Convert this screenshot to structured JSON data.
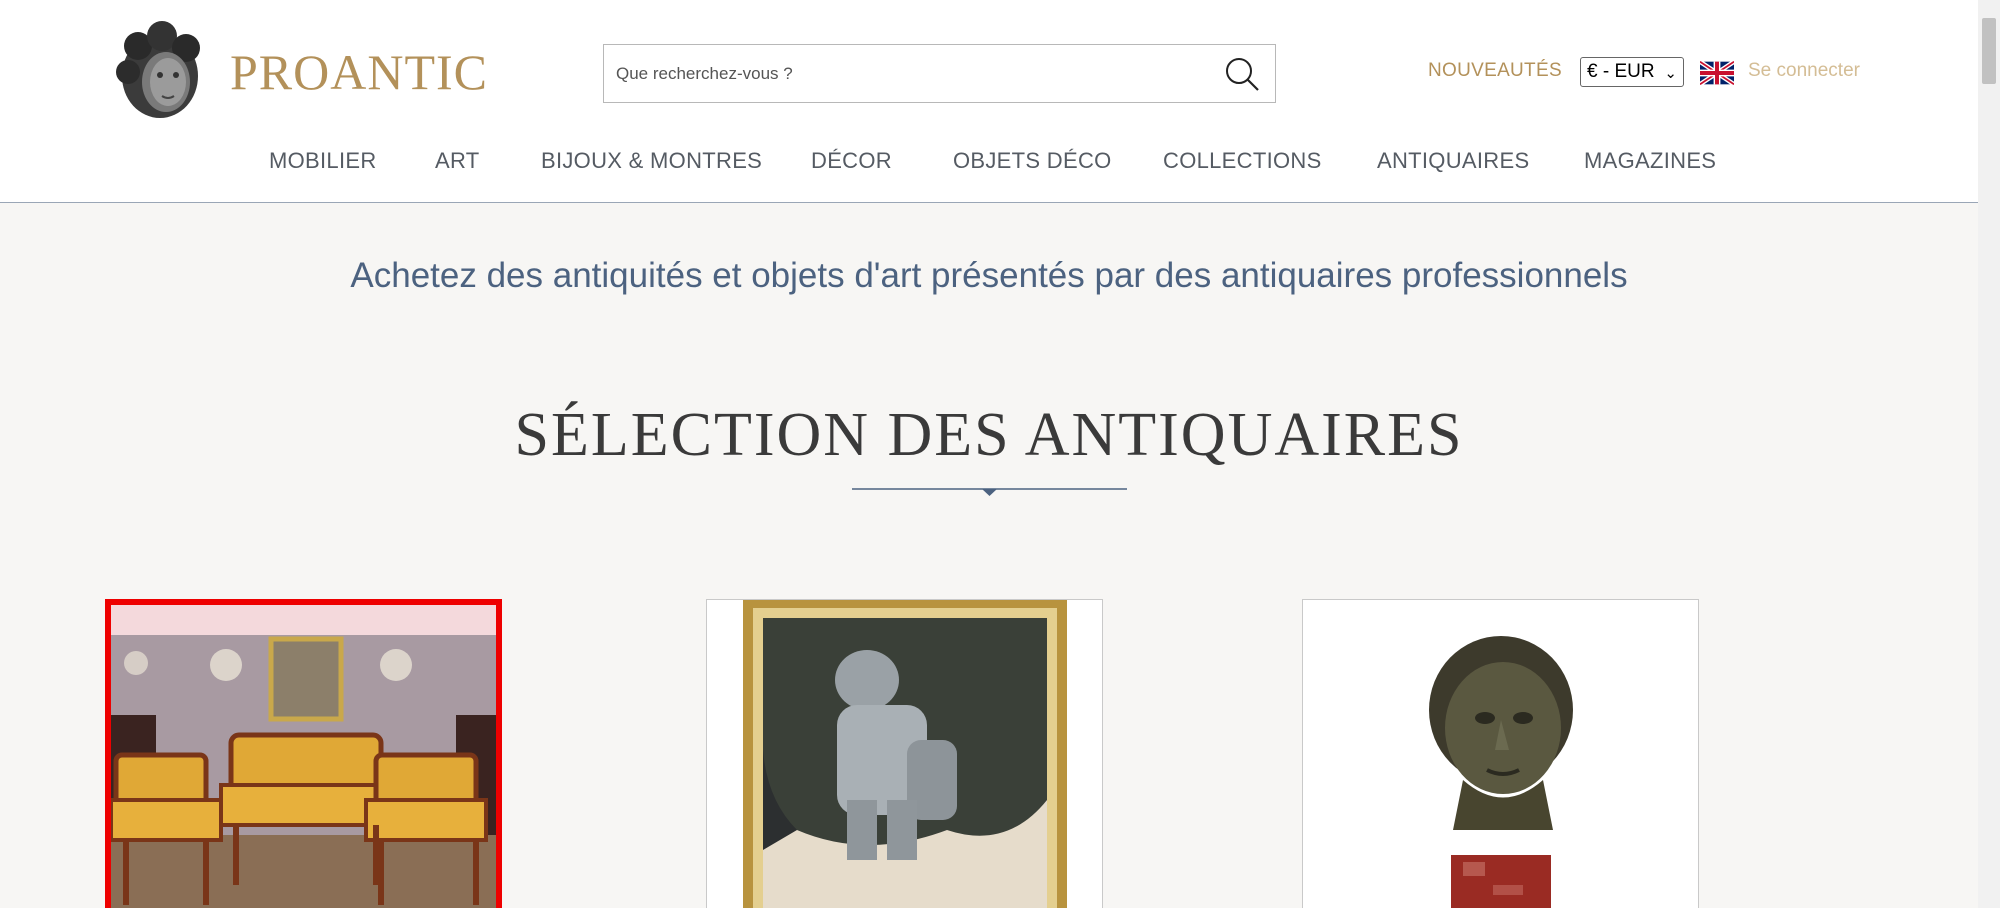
{
  "header": {
    "logo_text": "PROANTIC",
    "search": {
      "placeholder": "Que recherchez-vous ?",
      "value": ""
    },
    "new_link": "NOUVEAUTÉS",
    "currency": "€ - EUR",
    "login": "Se connecter"
  },
  "nav": {
    "items": [
      {
        "label": "MOBILIER"
      },
      {
        "label": "ART"
      },
      {
        "label": "BIJOUX & MONTRES"
      },
      {
        "label": "DÉCOR"
      },
      {
        "label": "OBJETS DÉCO"
      },
      {
        "label": "COLLECTIONS"
      },
      {
        "label": "ANTIQUAIRES"
      },
      {
        "label": "MAGAZINES"
      }
    ]
  },
  "main": {
    "tagline": "Achetez des antiquités et objets d'art présentés par des antiquaires professionnels",
    "section_title": "SÉLECTION DES ANTIQUAIRES"
  },
  "products": [
    {
      "subject": "empire salon set with sofa and armchairs",
      "selected": true
    },
    {
      "subject": "painting of a knight in armour in gilt frame",
      "selected": false
    },
    {
      "subject": "bronze bust of a young man on marble base",
      "selected": false
    }
  ],
  "colors": {
    "brand_gold": "#b3915a",
    "nav_text": "#555b63",
    "tagline": "#4c6280",
    "selection_border": "#ee0000"
  },
  "icons": [
    "logo-head-icon",
    "search-icon",
    "uk-flag-icon",
    "chevron-down-icon"
  ]
}
